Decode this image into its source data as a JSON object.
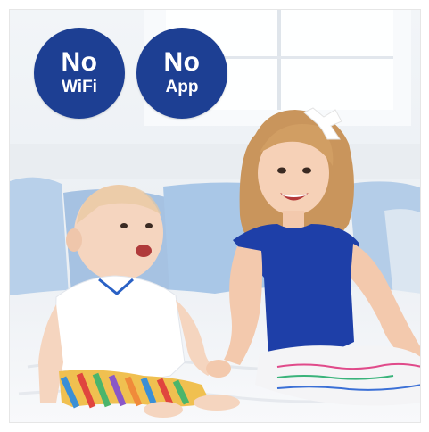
{
  "badges": [
    {
      "line1": "No",
      "line2": "WiFi"
    },
    {
      "line1": "No",
      "line2": "App"
    }
  ],
  "colors": {
    "badge": "#1d3f93",
    "wall": "#eef2f6",
    "pillow": "#a9c7e7",
    "dress": "#1e3fa8",
    "bed": "#f5f6f8"
  },
  "scene": "baby-and-girl-playing-on-bed"
}
